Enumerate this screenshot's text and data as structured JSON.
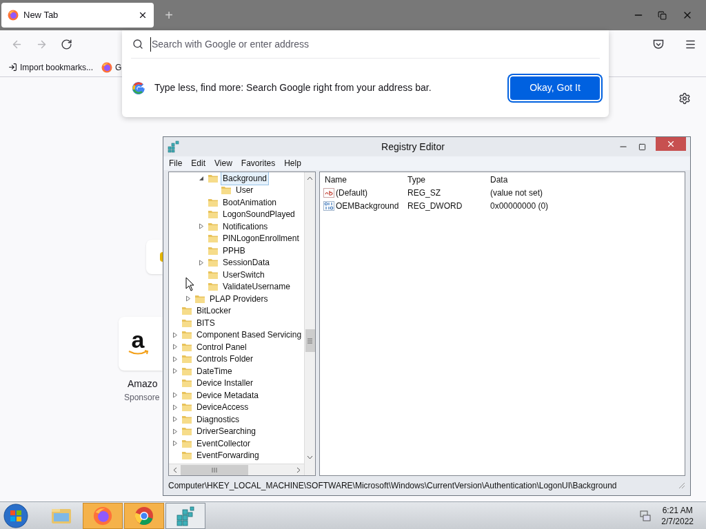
{
  "browser": {
    "tab": {
      "title": "New Tab",
      "selected": true
    },
    "new_tab_button": "+",
    "nav_buttons": [
      {
        "kind": "back",
        "disabled": true
      },
      {
        "kind": "forward",
        "disabled": true
      },
      {
        "kind": "reload",
        "disabled": false
      }
    ],
    "bookmarks": [
      {
        "kind": "import",
        "label": "Import bookmarks..."
      },
      {
        "kind": "firefox",
        "label": "G"
      }
    ],
    "address_popup": {
      "placeholder": "Search with Google or enter address",
      "message": "Type less, find more: Search Google right from your address bar.",
      "button": "Okay, Got It"
    },
    "shortcuts": [
      {
        "kind": "tile"
      },
      {
        "kind": "amazon",
        "logo": "a",
        "label": "Amazo",
        "sublabel": "Sponsore"
      }
    ]
  },
  "registry_editor": {
    "title": "Registry Editor",
    "menu": [
      "File",
      "Edit",
      "View",
      "Favorites",
      "Help"
    ],
    "tree": [
      {
        "children": [
          {
            "children": [
              {
                "label": "Background",
                "expanded": true,
                "selected": true,
                "children": [
                  {
                    "label": "User",
                    "selected": false
                  }
                ]
              },
              {
                "label": "BootAnimation",
                "selected": false
              },
              {
                "label": "LogonSoundPlayed",
                "selected": false
              },
              {
                "label": "Notifications",
                "expanded": false,
                "selected": false
              },
              {
                "label": "PINLogonEnrollment",
                "selected": false
              },
              {
                "label": "PPHB",
                "selected": false
              },
              {
                "label": "SessionData",
                "expanded": false,
                "selected": false
              },
              {
                "label": "UserSwitch",
                "selected": false
              },
              {
                "label": "ValidateUsername",
                "selected": false
              }
            ]
          },
          {
            "label": "PLAP Providers",
            "expanded": false,
            "selected": false
          }
        ]
      },
      {
        "label": "BitLocker",
        "selected": false
      },
      {
        "label": "BITS",
        "selected": false
      },
      {
        "label": "Component Based Servicing",
        "expanded": false,
        "selected": false
      },
      {
        "label": "Control Panel",
        "expanded": false,
        "selected": false
      },
      {
        "label": "Controls Folder",
        "expanded": false,
        "selected": false
      },
      {
        "label": "DateTime",
        "expanded": false,
        "selected": false
      },
      {
        "label": "Device Installer",
        "selected": false
      },
      {
        "label": "Device Metadata",
        "expanded": false,
        "selected": false
      },
      {
        "label": "DeviceAccess",
        "expanded": false,
        "selected": false
      },
      {
        "label": "Diagnostics",
        "expanded": false,
        "selected": false
      },
      {
        "label": "DriverSearching",
        "expanded": false,
        "selected": false
      },
      {
        "label": "EventCollector",
        "expanded": false,
        "selected": false
      },
      {
        "label": "EventForwarding",
        "selected": false
      }
    ],
    "columns": [
      "Name",
      "Type",
      "Data"
    ],
    "values": [
      {
        "kind": "string",
        "name": "(Default)",
        "type": "REG_SZ",
        "data": "(value not set)"
      },
      {
        "kind": "binary",
        "name": "OEMBackground",
        "type": "REG_DWORD",
        "data": "0x00000000 (0)"
      }
    ],
    "status": "Computer\\HKEY_LOCAL_MACHINE\\SOFTWARE\\Microsoft\\Windows\\CurrentVersion\\Authentication\\LogonUI\\Background"
  },
  "taskbar": {
    "apps": [
      {
        "kind": "explorer",
        "flashing": false,
        "active": false
      },
      {
        "kind": "firefox",
        "flashing": true,
        "active": false
      },
      {
        "kind": "chrome",
        "flashing": true,
        "active": false
      },
      {
        "kind": "regedit",
        "flashing": false,
        "active": true
      }
    ],
    "time": "6:21 AM",
    "date": "2/7/2022"
  }
}
